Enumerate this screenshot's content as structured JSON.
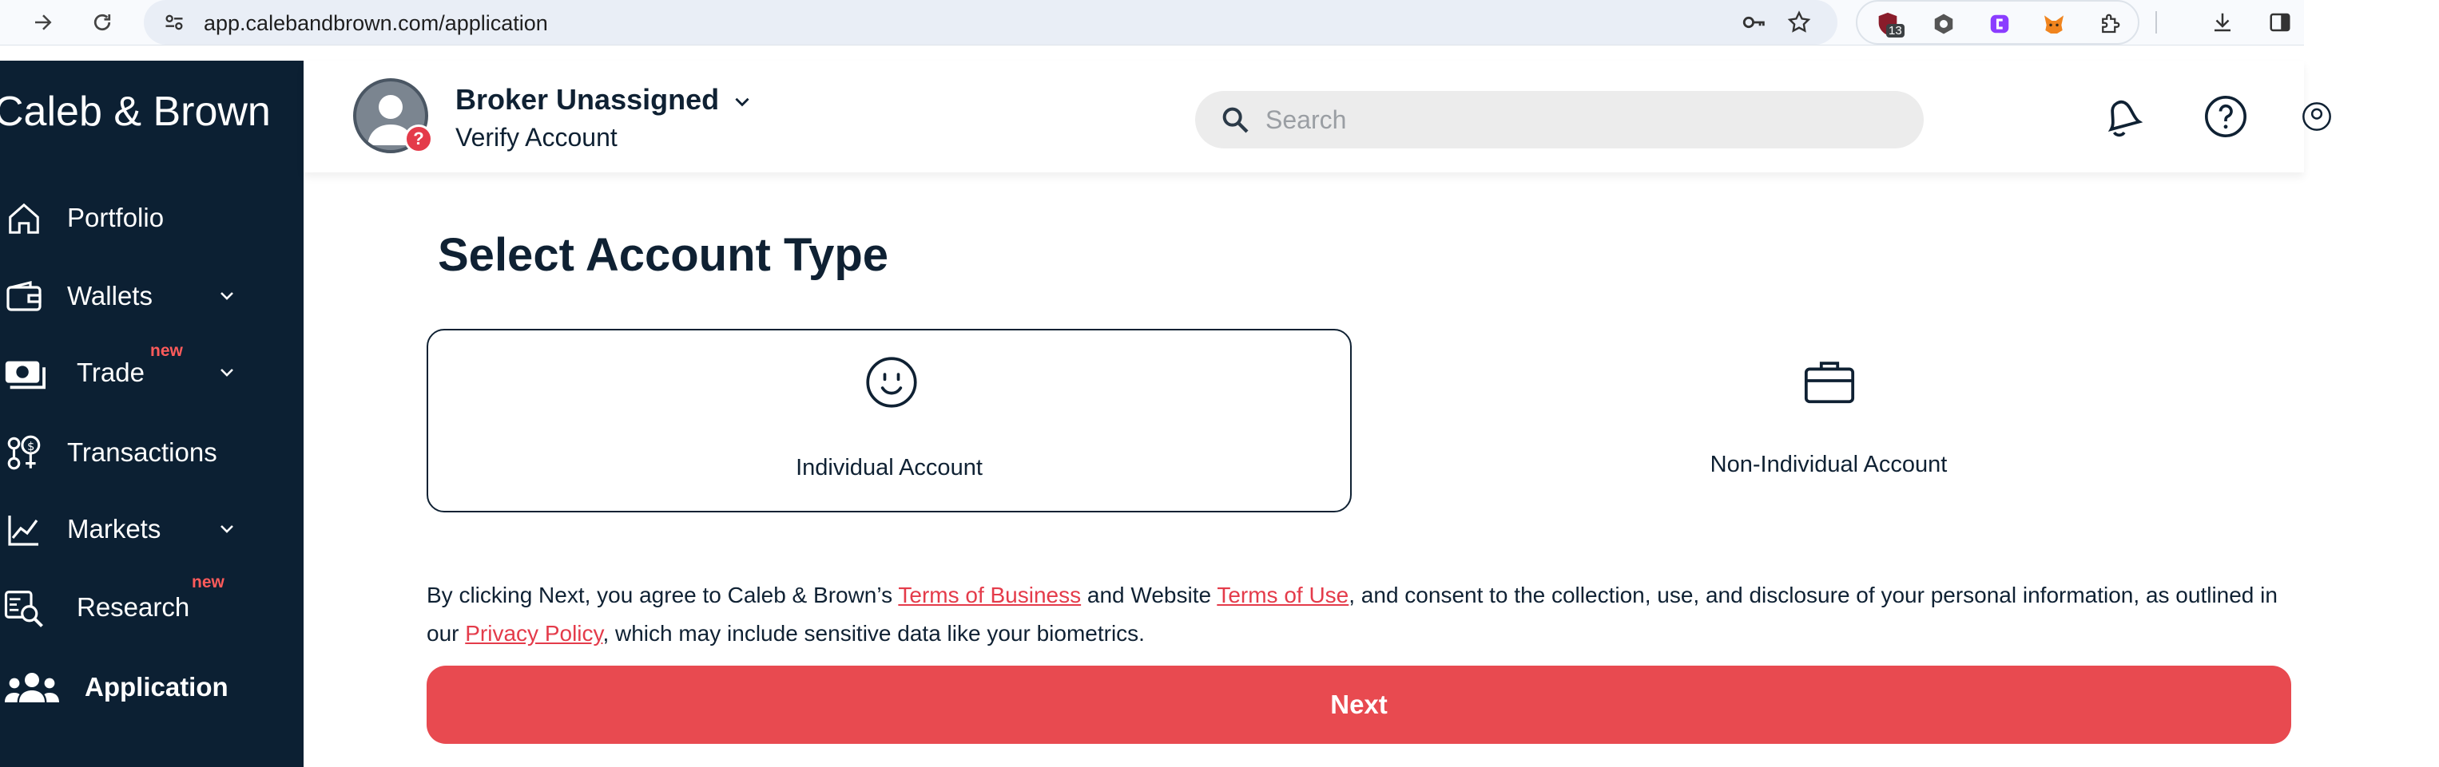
{
  "browser": {
    "url": "app.calebandbrown.com/application",
    "extension_badge_count": "13"
  },
  "sidebar": {
    "brand": "Caleb & Brown",
    "items": [
      {
        "label": "Portfolio"
      },
      {
        "label": "Wallets"
      },
      {
        "label": "Trade",
        "badge": "new"
      },
      {
        "label": "Transactions"
      },
      {
        "label": "Markets"
      },
      {
        "label": "Research",
        "badge": "new"
      },
      {
        "label": "Application"
      }
    ]
  },
  "header": {
    "broker": "Broker Unassigned",
    "status": "Verify Account",
    "avatar_badge": "?",
    "search_placeholder": "Search"
  },
  "main": {
    "title": "Select Account Type",
    "options": [
      {
        "label": "Individual Account",
        "icon": "smiley-icon",
        "selected": true
      },
      {
        "label": "Non-Individual Account",
        "icon": "briefcase-icon",
        "selected": false
      }
    ],
    "consent": {
      "part1": "By clicking Next, you agree to Caleb & Brown’s ",
      "link1": "Terms of Business",
      "part2": " and Website ",
      "link2": "Terms of Use",
      "part3": ", and consent to the collection, use, and disclosure of your personal information, as outlined in our ",
      "link3": "Privacy Policy",
      "part4": ", which may include sensitive data like your biometrics."
    },
    "next_label": "Next"
  },
  "colors": {
    "sidebar_bg": "#0c2033",
    "accent_red": "#e84a50",
    "link_red": "#e43b4a",
    "text_dark": "#0f2133"
  }
}
